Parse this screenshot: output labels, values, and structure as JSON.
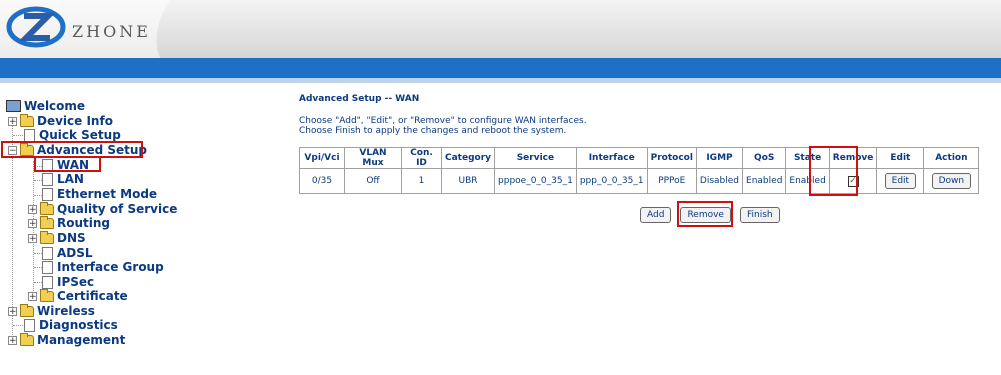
{
  "brand": {
    "logo_text": "ZHONE"
  },
  "tree": {
    "welcome": "Welcome",
    "device_info": "Device Info",
    "quick_setup": "Quick Setup",
    "advanced_setup": "Advanced Setup",
    "wan": "WAN",
    "lan": "LAN",
    "ethernet_mode": "Ethernet Mode",
    "qos": "Quality of Service",
    "routing": "Routing",
    "dns": "DNS",
    "adsl": "ADSL",
    "interface_group": "Interface Group",
    "ipsec": "IPSec",
    "certificate": "Certificate",
    "wireless": "Wireless",
    "diagnostics": "Diagnostics",
    "management": "Management"
  },
  "content": {
    "title": "Advanced Setup -- WAN",
    "desc_line1": "Choose \"Add\", \"Edit\", or \"Remove\" to configure WAN interfaces.",
    "desc_line2": "Choose Finish to apply the changes and reboot the system."
  },
  "table": {
    "headers": [
      "Vpi/Vci",
      "VLAN Mux",
      "Con. ID",
      "Category",
      "Service",
      "Interface",
      "Protocol",
      "IGMP",
      "QoS",
      "State",
      "Remove",
      "Edit",
      "Action"
    ],
    "rows": [
      {
        "vpivci": "0/35",
        "vlanmux": "Off",
        "conid": "1",
        "category": "UBR",
        "service": "pppoe_0_0_35_1",
        "interface": "ppp_0_0_35_1",
        "protocol": "PPPoE",
        "igmp": "Disabled",
        "qos": "Enabled",
        "state": "Enabled",
        "remove_checked": "✓",
        "edit_label": "Edit",
        "action_label": "Down"
      }
    ]
  },
  "buttons": {
    "add": "Add",
    "remove": "Remove",
    "finish": "Finish"
  },
  "colors": {
    "accent": "#1e6fc6",
    "text": "#0c3a80",
    "highlight": "#d01010"
  }
}
